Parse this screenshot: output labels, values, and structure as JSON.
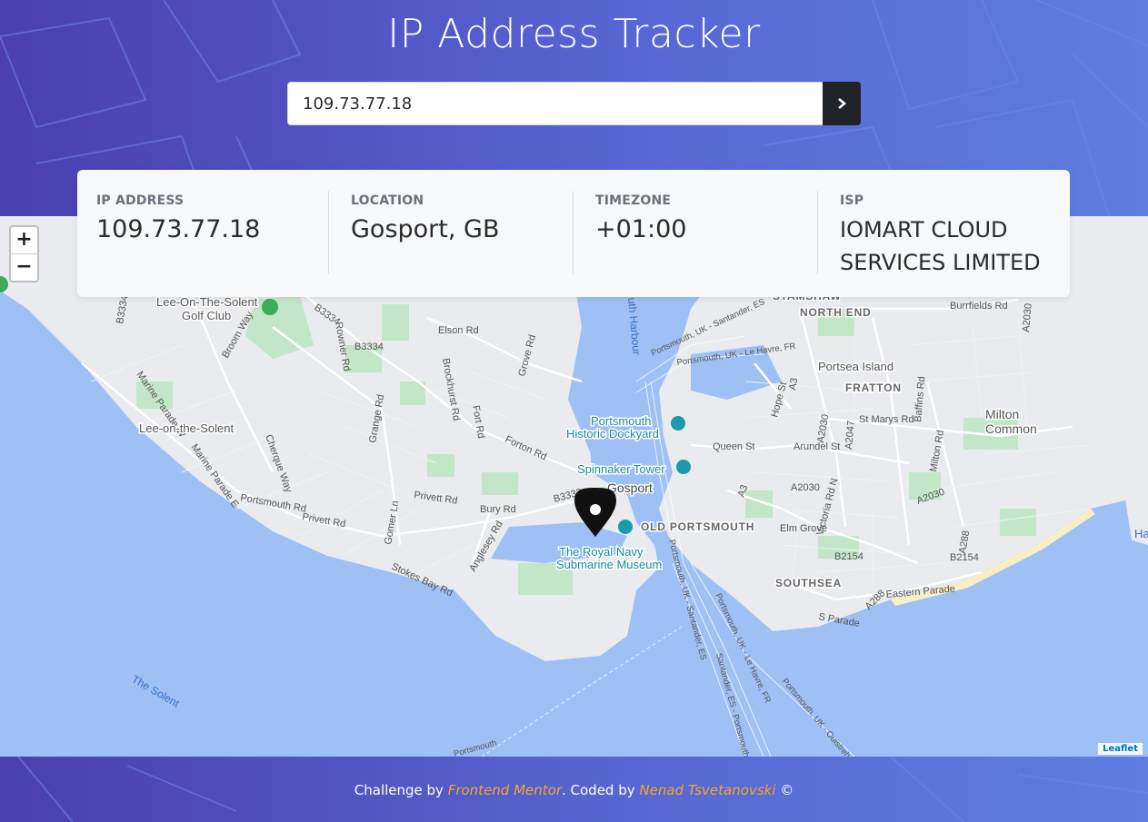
{
  "header": {
    "title": "IP Address Tracker",
    "search_value": "109.73.77.18",
    "search_button_icon": "chevron-right-icon"
  },
  "info": [
    {
      "label": "IP ADDRESS",
      "value": "109.73.77.18"
    },
    {
      "label": "LOCATION",
      "value": "Gosport, GB"
    },
    {
      "label": "TIMEZONE",
      "value": "+01:00"
    },
    {
      "label": "ISP",
      "value": "IOMART CLOUD SERVICES LIMITED"
    }
  ],
  "map": {
    "zoom_in": "+",
    "zoom_out": "−",
    "attribution": "Leaflet",
    "marker_icon": "location-pin-icon",
    "labels": {
      "lee_golf": "Lee-On-The-Solent",
      "golf_club": "Golf Club",
      "lee_town": "Lee-on-the-Solent",
      "the_solent": "The Solent",
      "gosport": "Gosport",
      "historic_dockyard_1": "Portsmouth",
      "historic_dockyard_2": "Historic Dockyard",
      "spinnaker": "Spinnaker Tower",
      "old_portsmouth": "OLD PORTSMOUTH",
      "navy_museum_1": "The Royal Navy",
      "navy_museum_2": "Submarine Museum",
      "portsea": "Portsea Island",
      "north_end": "NORTH END",
      "fratton": "FRATTON",
      "milton_1": "Milton",
      "milton_2": "Common",
      "southsea": "SOUTHSEA",
      "hayling": "Hayling",
      "harbour": "uth Harbour",
      "stamshaw": "STAMSHAW"
    },
    "roads": {
      "b3334_a": "B3334",
      "b3334_b": "B3334",
      "b3333": "B3333",
      "elson": "Elson Rd",
      "grove": "Grove Rd",
      "brockhurst": "Brockhurst Rd",
      "fort": "Fort Rd",
      "forton": "Forton Rd",
      "privett": "Privett Rd",
      "bury": "Bury Rd",
      "stokes": "Stokes Bay Rd",
      "anglesey": "Anglesey Rd",
      "gomer": "Gomer Ln",
      "cherque": "Cherque Way",
      "marine_w": "Marine Parade W",
      "marine_e": "Marine Parade E",
      "broom": "Broom Way",
      "queen": "Queen St",
      "arundel": "Arundel St",
      "a2030a": "A2030",
      "a2030b": "A2030",
      "elm": "Elm Grove",
      "victoria": "Victoria Rd N",
      "b2154a": "B2154",
      "b2154b": "B2154",
      "eastern": "Eastern Parade",
      "sparade": "S Parade",
      "stmarys": "St Marys Rd",
      "burrfields": "Burrfields Rd",
      "a2047": "A2047",
      "a3": "A3",
      "a288": "A288",
      "a2030c": "A2030",
      "ferry1": "Portsmouth, UK - Santander, ES",
      "ferry2": "Portsmouth, UK - Le Havre, FR",
      "ferry3": "Portsmouth, UK - Santander, ES",
      "ferry4": "Portsmouth, UK - Le Havre, FR",
      "ferry5": "Portsmouth, UK - Ouistreham, FR",
      "ferry6": "Santander, ES - Portsmouth, UK"
    }
  },
  "footer": {
    "prefix": "Challenge by ",
    "link1": "Frontend Mentor",
    "middle": ". Coded by ",
    "link2": "Nenad Tsvetanovski",
    "suffix": " ©"
  },
  "colors": {
    "header_gradient_start": "#4a3fae",
    "header_gradient_end": "#5f7ee0",
    "footer_link": "#f5a623",
    "water": "#9ec0f5",
    "land": "#e9ebee",
    "green": "#c3e6c9"
  }
}
